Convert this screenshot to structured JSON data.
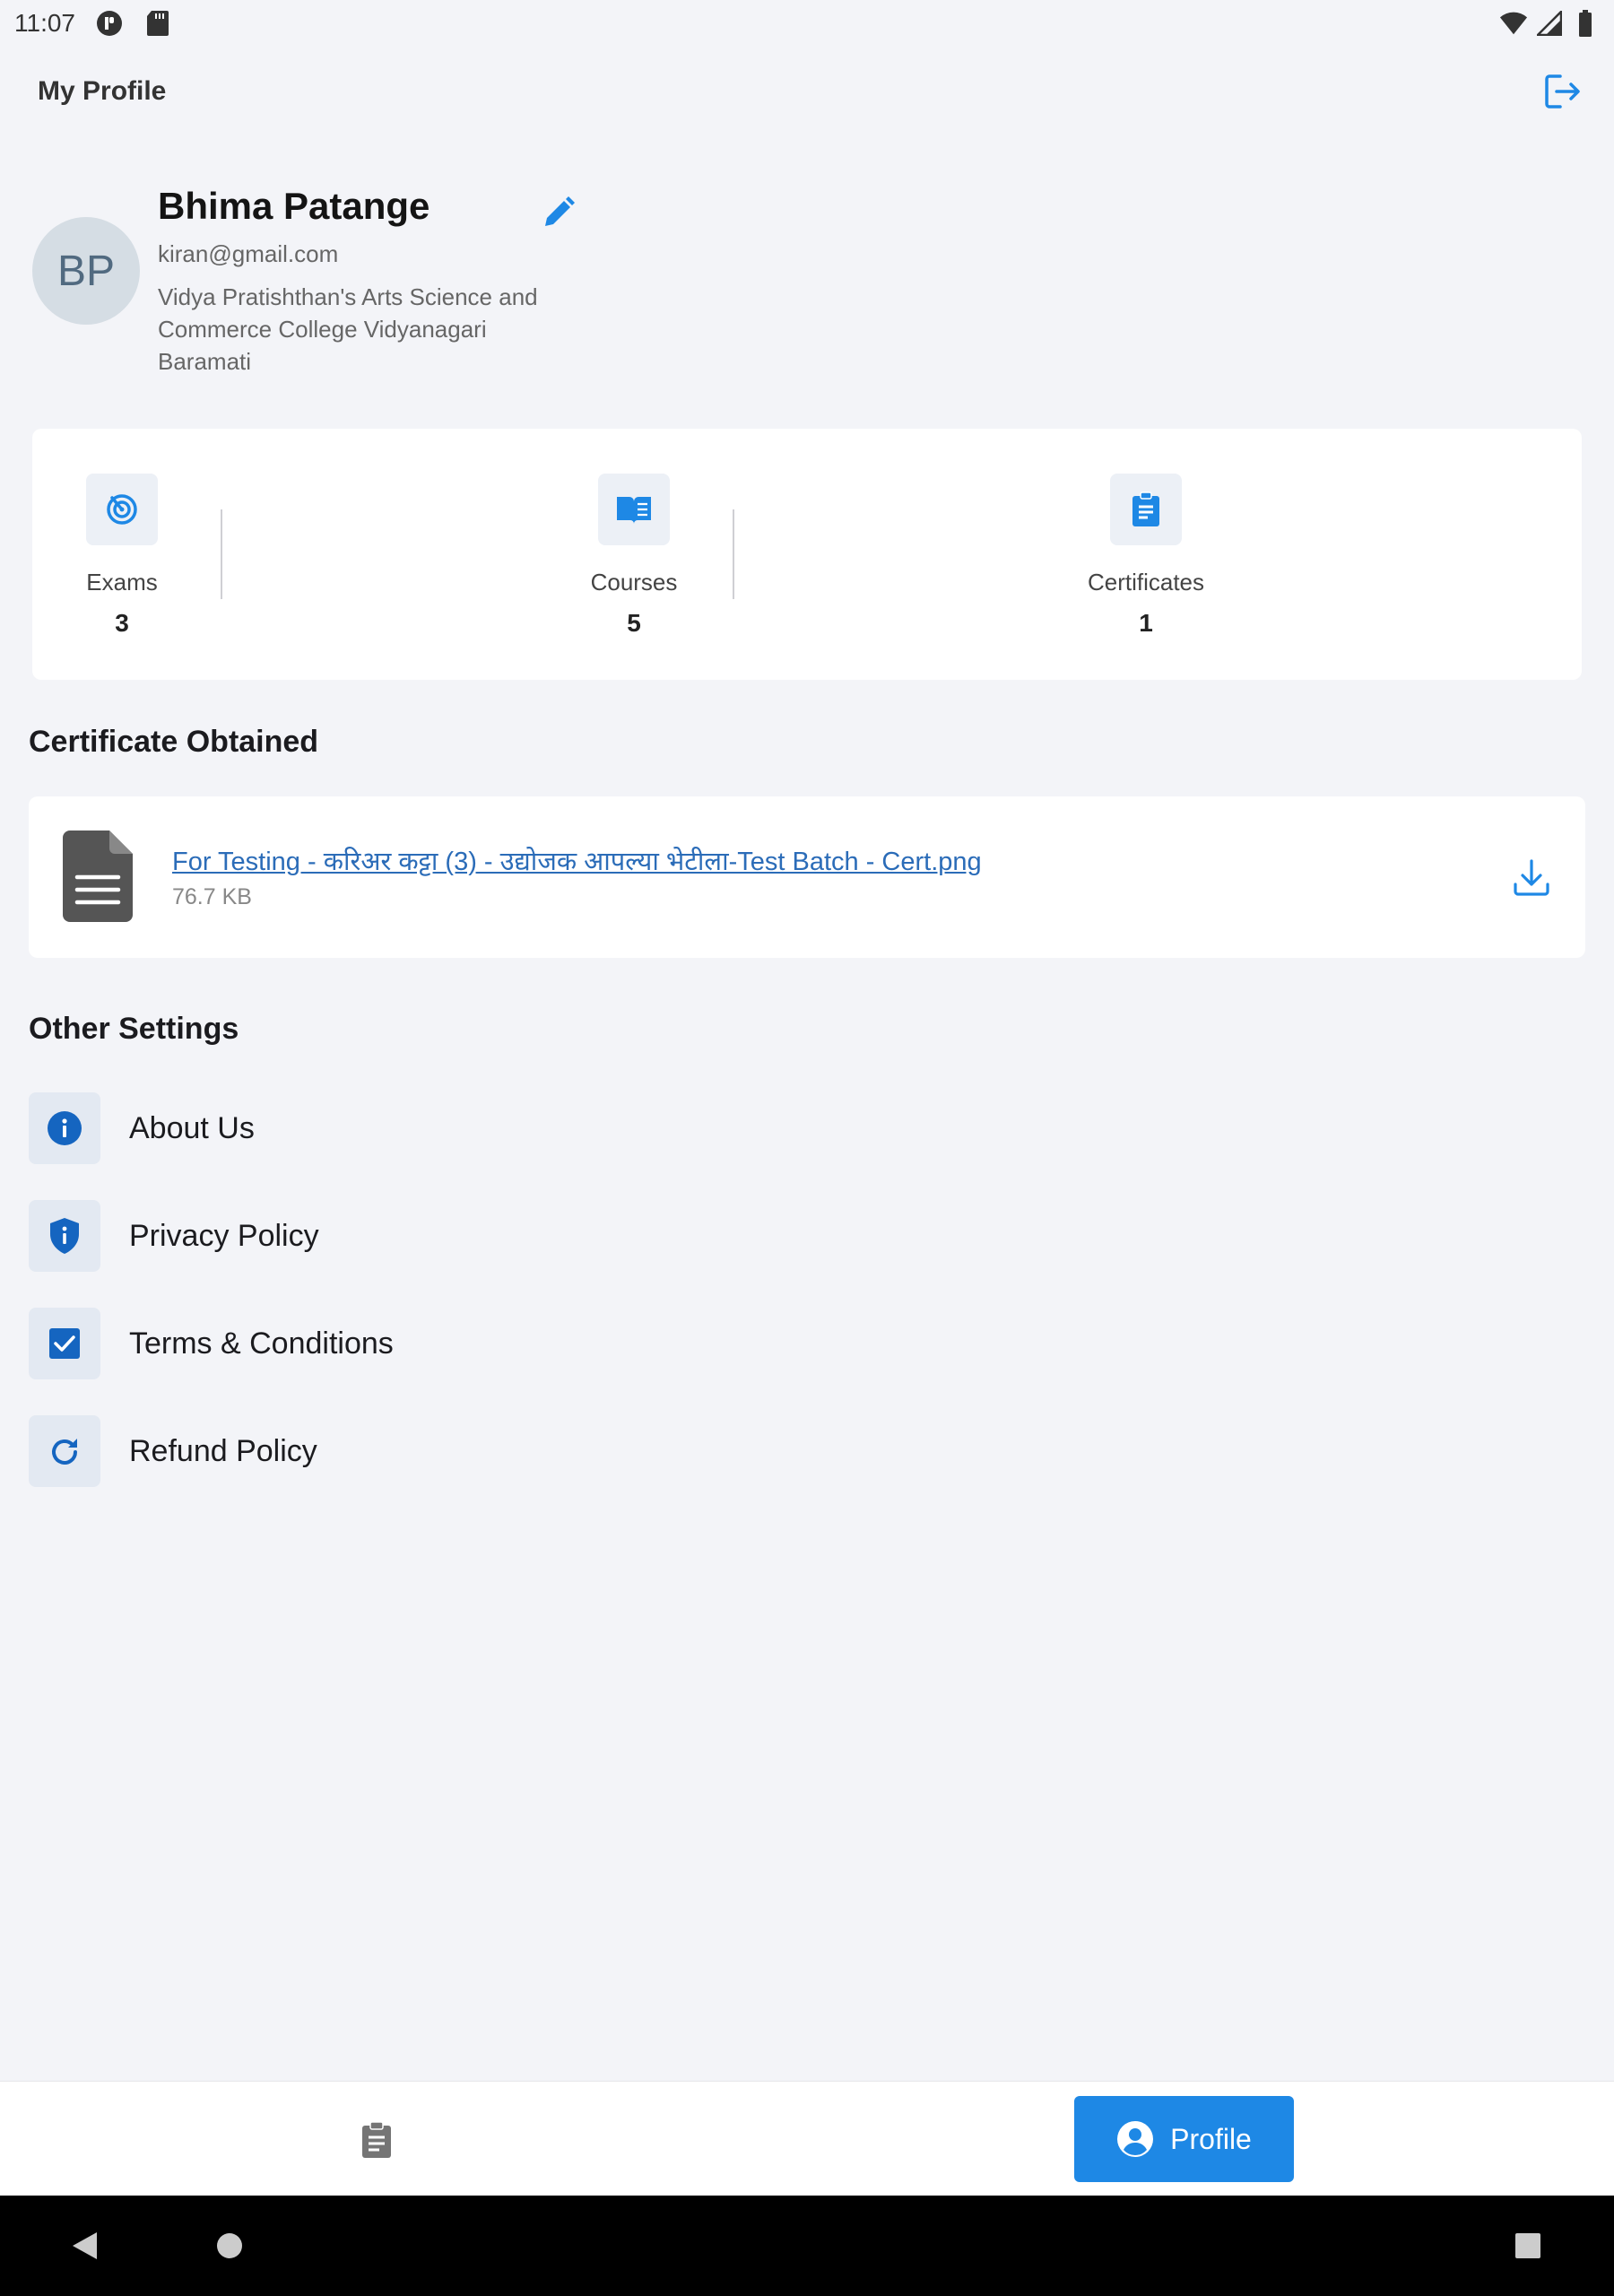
{
  "status_bar": {
    "time": "11:07"
  },
  "header": {
    "title": "My Profile"
  },
  "profile": {
    "initials": "BP",
    "name": "Bhima Patange",
    "email": "kiran@gmail.com",
    "college": "Vidya Pratishthan's Arts Science and Commerce College Vidyanagari Baramati"
  },
  "stats": [
    {
      "label": "Exams",
      "value": "3",
      "icon": "target-icon"
    },
    {
      "label": "Courses",
      "value": "5",
      "icon": "book-icon"
    },
    {
      "label": "Certificates",
      "value": "1",
      "icon": "clipboard-icon"
    }
  ],
  "certificates": {
    "title": "Certificate Obtained",
    "items": [
      {
        "name": "For Testing - करिअर कट्टा (3) - उद्योजक आपल्या भेटीला-Test Batch - Cert.png",
        "size": "76.7 KB"
      }
    ]
  },
  "settings": {
    "title": "Other Settings",
    "items": [
      {
        "label": "About Us",
        "icon": "info-icon"
      },
      {
        "label": "Privacy Policy",
        "icon": "shield-icon"
      },
      {
        "label": "Terms & Conditions",
        "icon": "checkbox-icon"
      },
      {
        "label": "Refund Policy",
        "icon": "refresh-icon"
      }
    ]
  },
  "bottom_nav": {
    "profile_label": "Profile"
  },
  "colors": {
    "accent": "#1e88e5",
    "link": "#2b6cb8",
    "background": "#f3f4f8"
  }
}
